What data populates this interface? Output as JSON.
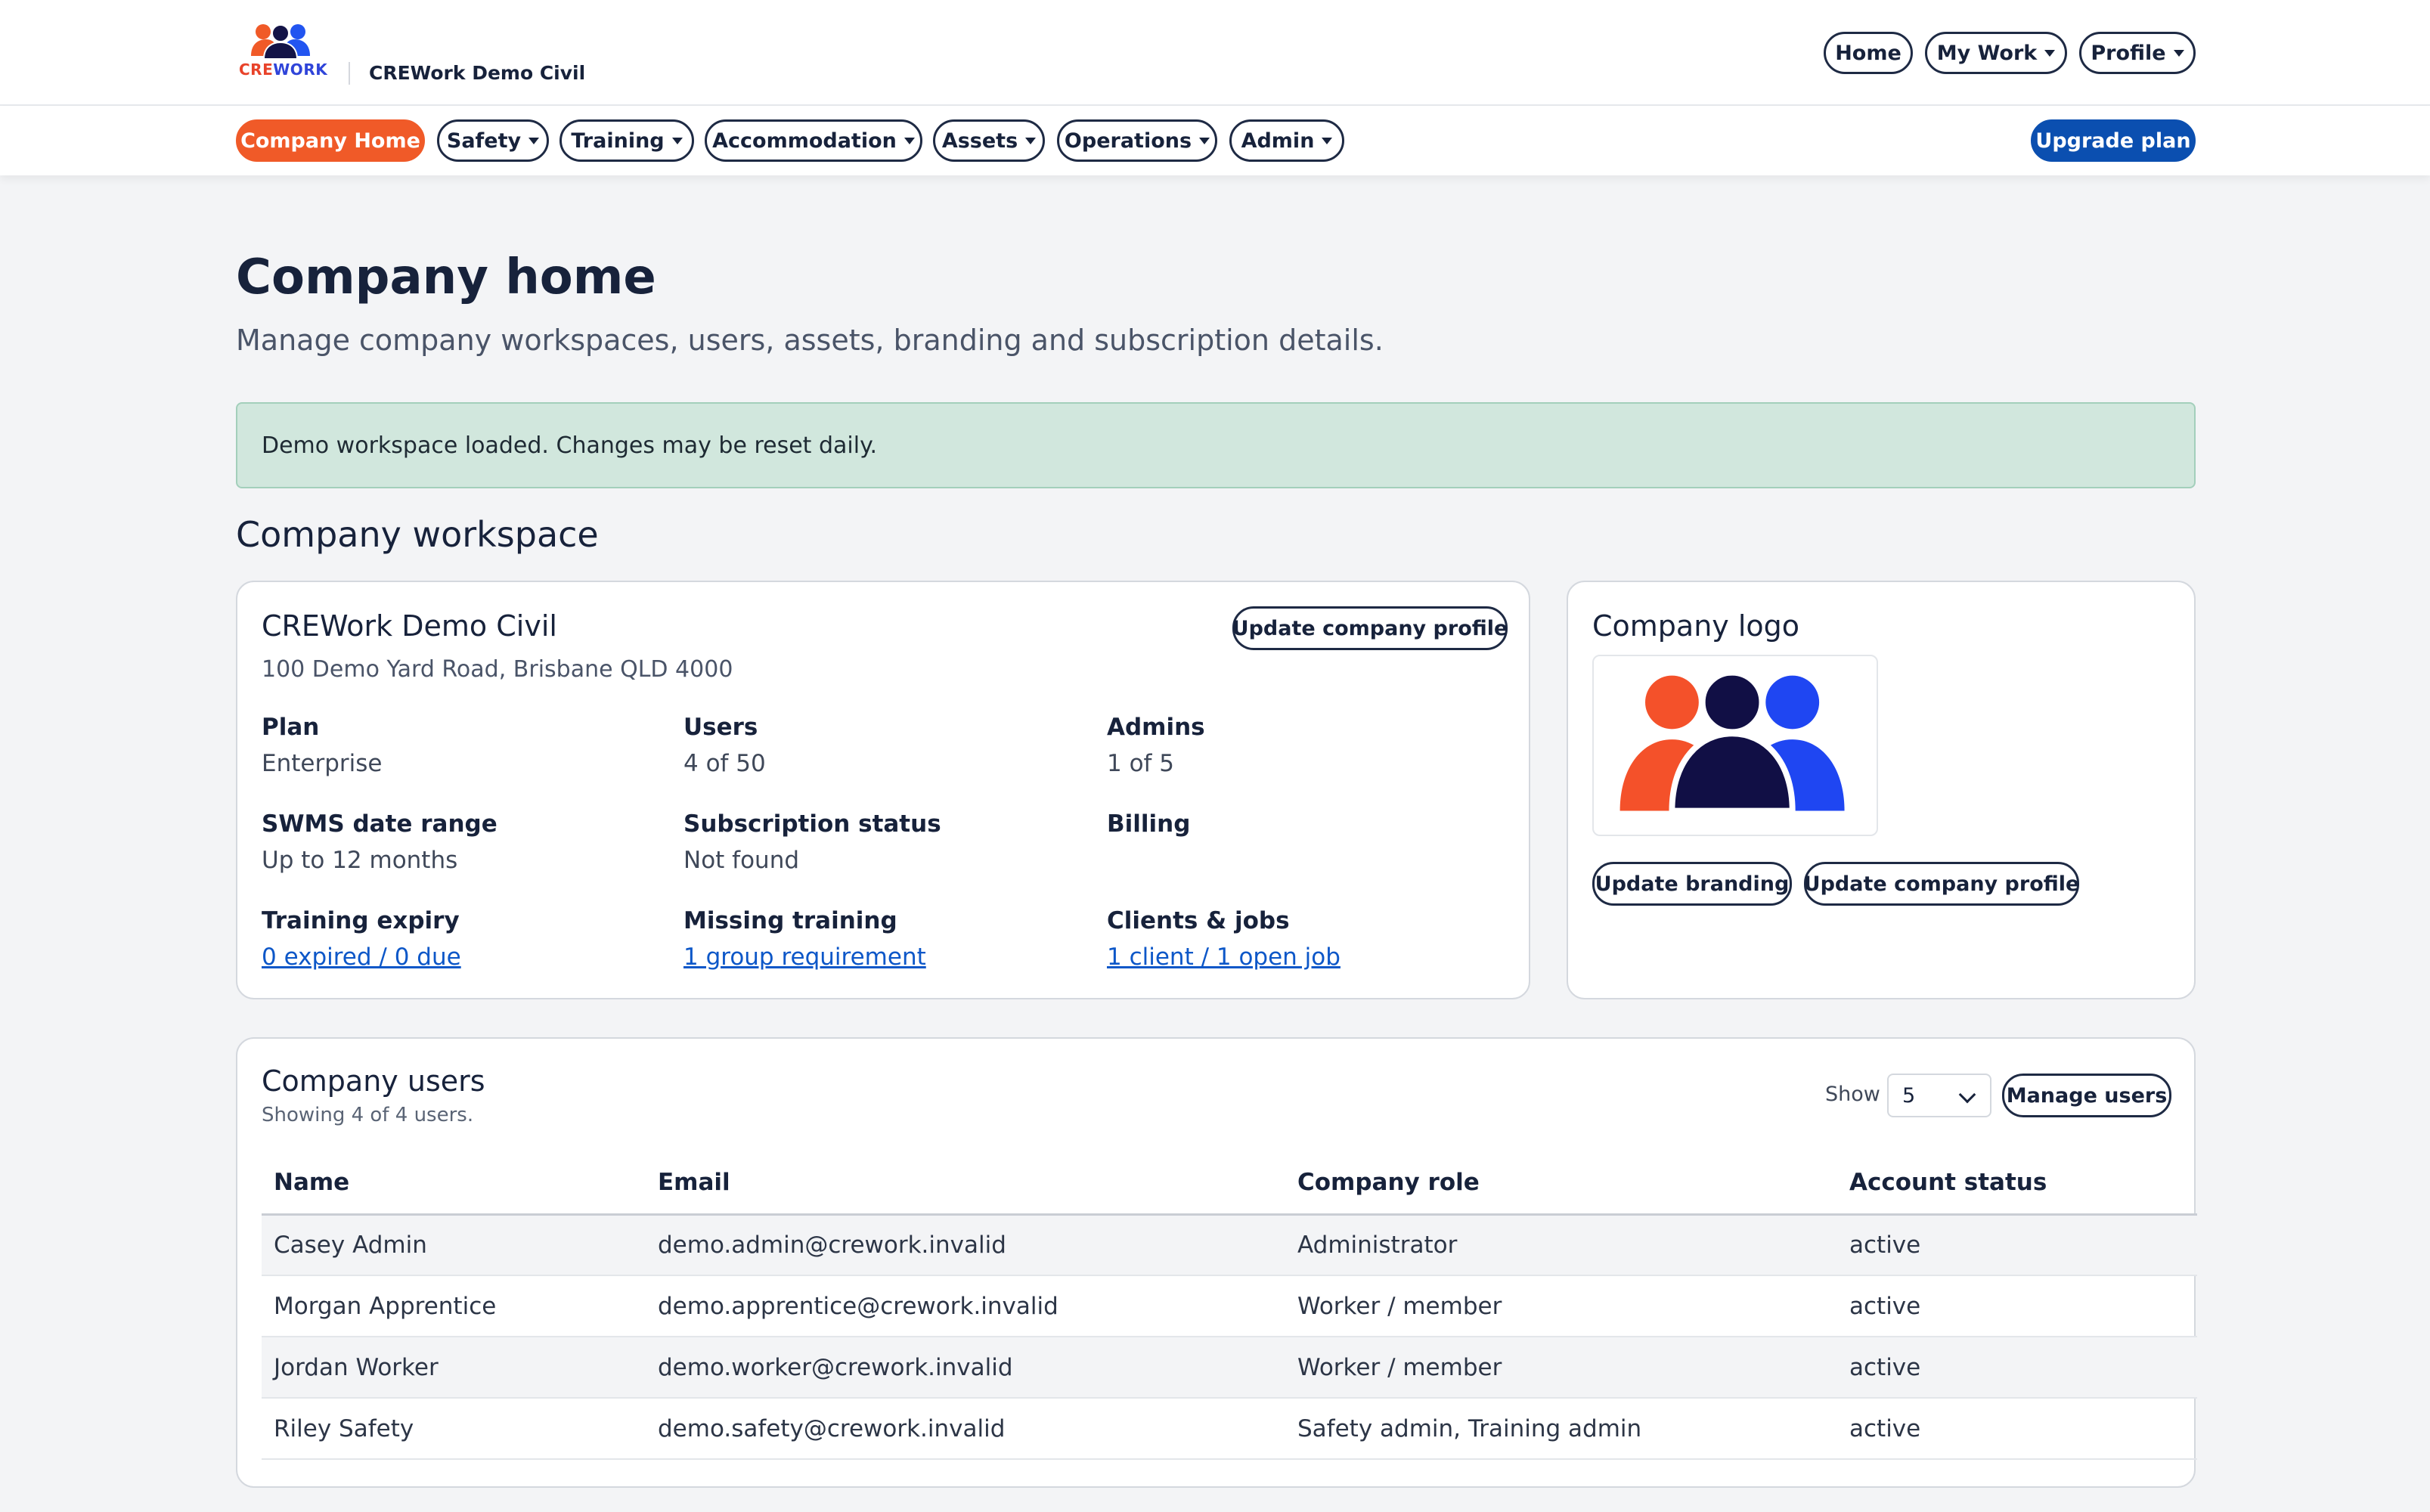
{
  "brand": {
    "logo_word_part1": "CRE",
    "logo_word_part2": "WORK",
    "company_name": "CREWork Demo Civil",
    "colors": {
      "orange": "#f05a28",
      "navy": "#17223b",
      "blue": "#2255f0",
      "upgrade": "#0b4fb0"
    }
  },
  "top_nav": {
    "home": "Home",
    "my_work": "My Work",
    "profile": "Profile"
  },
  "main_nav": {
    "items": [
      "Company Home",
      "Safety",
      "Training",
      "Accommodation",
      "Assets",
      "Operations",
      "Admin"
    ],
    "active": "Company Home",
    "upgrade": "Upgrade plan"
  },
  "page": {
    "title": "Company home",
    "subtitle": "Manage company workspaces, users, assets, branding and subscription details.",
    "alert": "Demo workspace loaded. Changes may be reset daily.",
    "section_title": "Company workspace"
  },
  "workspace_card": {
    "name": "CREWork Demo Civil",
    "address": "100 Demo Yard Road, Brisbane QLD 4000",
    "update_button": "Update company profile",
    "stats": {
      "plan": {
        "label": "Plan",
        "value": "Enterprise"
      },
      "users": {
        "label": "Users",
        "value": "4 of 50"
      },
      "admins": {
        "label": "Admins",
        "value": "1 of 5"
      },
      "swms": {
        "label": "SWMS date range",
        "value": "Up to 12 months"
      },
      "subscription": {
        "label": "Subscription status",
        "value": "Not found"
      },
      "billing": {
        "label": "Billing",
        "value": ""
      },
      "training_expiry": {
        "label": "Training expiry",
        "value": "0 expired / 0 due"
      },
      "missing_training": {
        "label": "Missing training",
        "value": "1 group requirement"
      },
      "clients_jobs": {
        "label": "Clients & jobs",
        "value": "1 client / 1 open job"
      }
    }
  },
  "logo_card": {
    "title": "Company logo",
    "update_branding": "Update branding",
    "update_profile": "Update company profile"
  },
  "users_card": {
    "title": "Company users",
    "showing": "Showing 4 of 4 users.",
    "show_label": "Show",
    "page_size": "5",
    "manage_button": "Manage users",
    "columns": [
      "Name",
      "Email",
      "Company role",
      "Account status"
    ],
    "rows": [
      [
        "Casey Admin",
        "demo.admin@crework.invalid",
        "Administrator",
        "active"
      ],
      [
        "Morgan Apprentice",
        "demo.apprentice@crework.invalid",
        "Worker / member",
        "active"
      ],
      [
        "Jordan Worker",
        "demo.worker@crework.invalid",
        "Worker / member",
        "active"
      ],
      [
        "Riley Safety",
        "demo.safety@crework.invalid",
        "Safety admin, Training admin",
        "active"
      ]
    ]
  }
}
